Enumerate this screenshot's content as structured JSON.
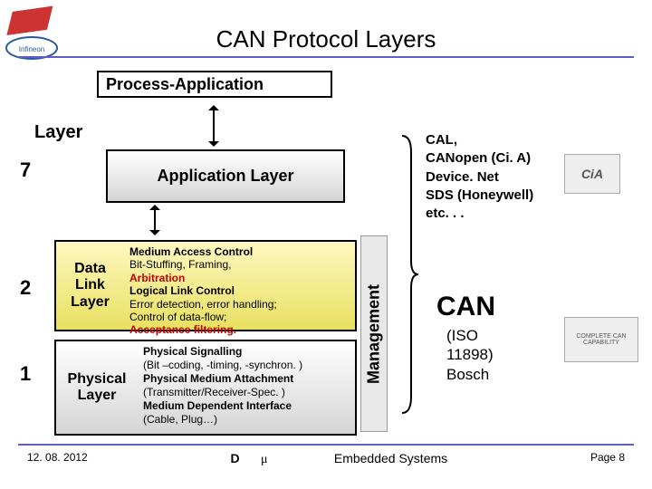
{
  "title": "CAN Protocol Layers",
  "header_box": "Process-Application",
  "layer_label": "Layer",
  "numbers": {
    "n7": "7",
    "n2": "2",
    "n1": "1"
  },
  "app_layer": "Application Layer",
  "dll": {
    "name_l1": "Data",
    "name_l2": "Link",
    "name_l3": "Layer",
    "mac": "Medium Access Control",
    "mac_d1": "Bit-Stuffing, Framing,",
    "mac_d2": "Arbitration",
    "llc": "Logical Link Control",
    "llc_d1": "Error detection, error handling;",
    "llc_d2": "Control of data-flow;",
    "llc_d3": "Acceptance filtering."
  },
  "phy": {
    "name_l1": "Physical",
    "name_l2": "Layer",
    "ps": "Physical Signalling",
    "ps_d": "(Bit –coding, -timing, -synchron. )",
    "pma": "Physical Medium Attachment",
    "pma_d": "(Transmitter/Receiver-Spec. )",
    "mdi": "Medium Dependent Interface",
    "mdi_d": "(Cable, Plug…)"
  },
  "management": "Management",
  "examples": {
    "l1": "CAL,",
    "l2": "CANopen (Ci. A)",
    "l3": "Device. Net",
    "l4": "SDS (Honeywell)",
    "l5": "etc. . ."
  },
  "can": {
    "title": "CAN",
    "sub1": "(ISO",
    "sub2": "11898)",
    "sub3": "Bosch"
  },
  "logos": {
    "cia": "CiA",
    "ccc": "COMPLETE CAN CAPABILITY"
  },
  "footer": {
    "date": "12. 08. 2012",
    "d": "D",
    "mu": "μ",
    "mid": "Embedded Systems",
    "page": "Page 8"
  }
}
